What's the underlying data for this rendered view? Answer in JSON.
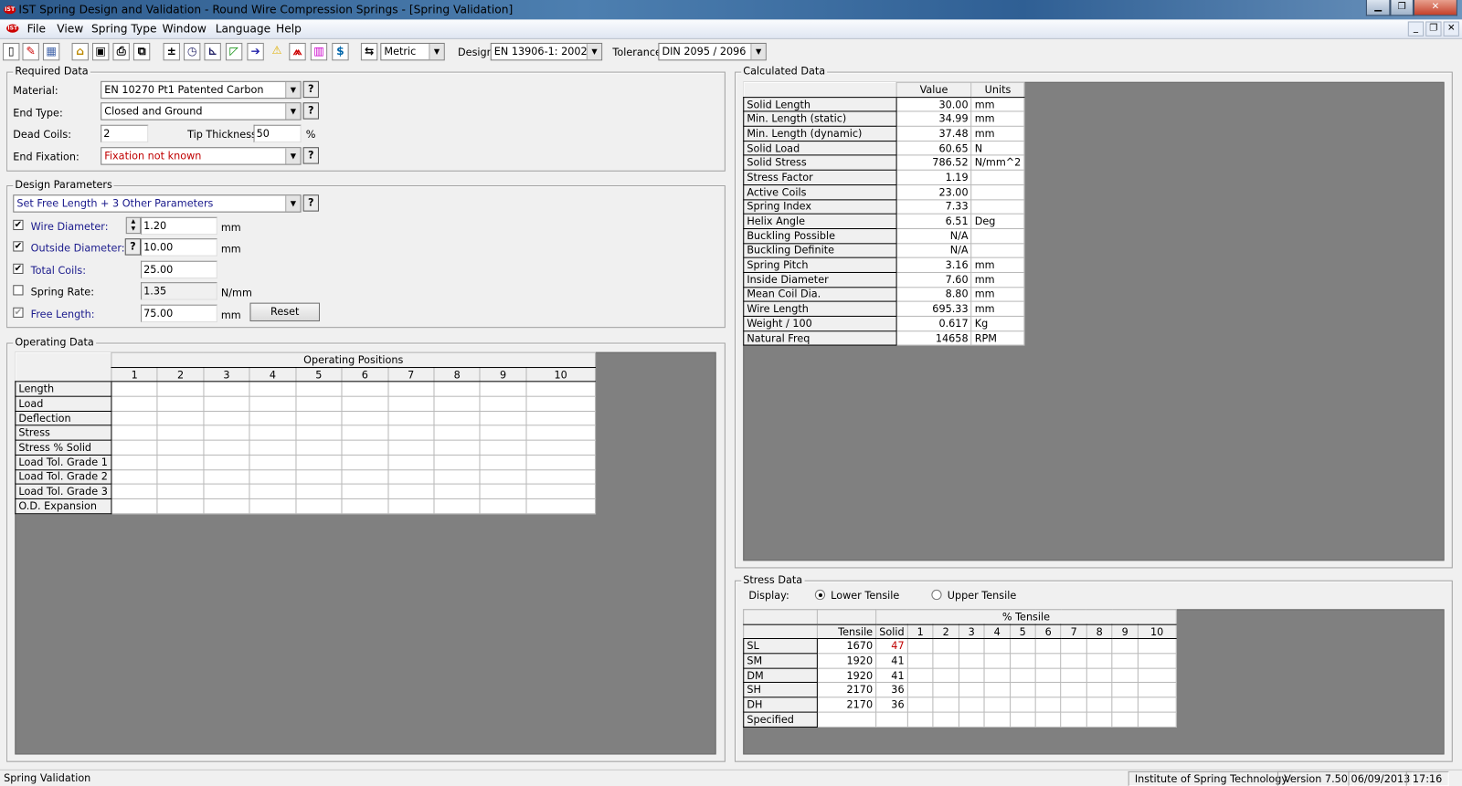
{
  "window": {
    "title": "IST Spring Design and Validation - Round Wire Compression Springs - [Spring Validation]",
    "logo": "IST"
  },
  "menu": [
    "File",
    "View",
    "Spring Type",
    "Window",
    "Language",
    "Help"
  ],
  "toolbar": {
    "icons": [
      "new-icon",
      "edit-icon",
      "calculator-icon",
      "open-icon",
      "save-icon",
      "print-icon",
      "copy-icon",
      "tolerance-icon",
      "clock-icon",
      "graph-icon",
      "chart-icon",
      "arrow-icon",
      "warning-icon",
      "spring-icon",
      "compare-icon",
      "cost-icon",
      "units-icon"
    ],
    "units": "Metric",
    "design_label": "Design:",
    "design": "EN 13906-1: 2002",
    "tolerance_label": "Tolerance:",
    "tolerance": "DIN 2095 / 2096"
  },
  "required": {
    "title": "Required Data",
    "material_label": "Material:",
    "material": "EN 10270 Pt1 Patented Carbon",
    "end_type_label": "End Type:",
    "end_type": "Closed and Ground",
    "dead_coils_label": "Dead Coils:",
    "dead_coils": "2",
    "tip_label": "Tip Thickness:",
    "tip": "50",
    "tip_unit": "%",
    "fixation_label": "End Fixation:",
    "fixation": "Fixation not known",
    "help": "?"
  },
  "design": {
    "title": "Design Parameters",
    "mode": "Set Free Length + 3 Other Parameters",
    "params": [
      {
        "label": "Wire Diameter:",
        "value": "1.20",
        "unit": "mm",
        "checked": true
      },
      {
        "label": "Outside Diameter:",
        "value": "10.00",
        "unit": "mm",
        "checked": true
      },
      {
        "label": "Total Coils:",
        "value": "25.00",
        "unit": "",
        "checked": true
      },
      {
        "label": "Spring Rate:",
        "value": "1.35",
        "unit": "N/mm",
        "checked": false
      },
      {
        "label": "Free Length:",
        "value": "75.00",
        "unit": "mm",
        "checked": true
      }
    ],
    "reset": "Reset"
  },
  "operating": {
    "title": "Operating Data",
    "header": "Operating Positions",
    "positions": [
      "1",
      "2",
      "3",
      "4",
      "5",
      "6",
      "7",
      "8",
      "9",
      "10"
    ],
    "rows": [
      "Length",
      "Load",
      "Deflection",
      "Stress",
      "Stress % Solid",
      "Load Tol. Grade 1",
      "Load Tol. Grade 2",
      "Load Tol. Grade 3",
      "O.D. Expansion"
    ]
  },
  "calculated": {
    "title": "Calculated Data",
    "headers": [
      "Value",
      "Units"
    ],
    "rows": [
      [
        "Solid Length",
        "30.00",
        "mm"
      ],
      [
        "Min. Length (static)",
        "34.99",
        "mm"
      ],
      [
        "Min. Length (dynamic)",
        "37.48",
        "mm"
      ],
      [
        "Solid Load",
        "60.65",
        "N"
      ],
      [
        "Solid Stress",
        "786.52",
        "N/mm^2"
      ],
      [
        "Stress Factor",
        "1.19",
        ""
      ],
      [
        "Active Coils",
        "23.00",
        ""
      ],
      [
        "Spring Index",
        "7.33",
        ""
      ],
      [
        "Helix Angle",
        "6.51",
        "Deg"
      ],
      [
        "Buckling Possible",
        "N/A",
        ""
      ],
      [
        "Buckling Definite",
        "N/A",
        ""
      ],
      [
        "Spring Pitch",
        "3.16",
        "mm"
      ],
      [
        "Inside Diameter",
        "7.60",
        "mm"
      ],
      [
        "Mean Coil Dia.",
        "8.80",
        "mm"
      ],
      [
        "Wire Length",
        "695.33",
        "mm"
      ],
      [
        "Weight / 100",
        "0.617",
        "Kg"
      ],
      [
        "Natural Freq",
        "14658",
        "RPM"
      ]
    ]
  },
  "stress": {
    "title": "Stress Data",
    "display_label": "Display:",
    "lower": "Lower Tensile",
    "upper": "Upper Tensile",
    "selected": "lower",
    "group_header": "% Tensile",
    "tensile_header": "Tensile",
    "solid_header": "Solid",
    "positions": [
      "1",
      "2",
      "3",
      "4",
      "5",
      "6",
      "7",
      "8",
      "9",
      "10"
    ],
    "rows": [
      [
        "SL",
        "1670",
        "47"
      ],
      [
        "SM",
        "1920",
        "41"
      ],
      [
        "DM",
        "1920",
        "41"
      ],
      [
        "SH",
        "2170",
        "36"
      ],
      [
        "DH",
        "2170",
        "36"
      ],
      [
        "Specified",
        "",
        ""
      ]
    ],
    "warn_color": "#c00000"
  },
  "status": {
    "left": "Spring Validation",
    "org": "Institute of Spring Technology",
    "version": "Version 7.50",
    "date": "06/09/2013",
    "time": "17:16"
  }
}
